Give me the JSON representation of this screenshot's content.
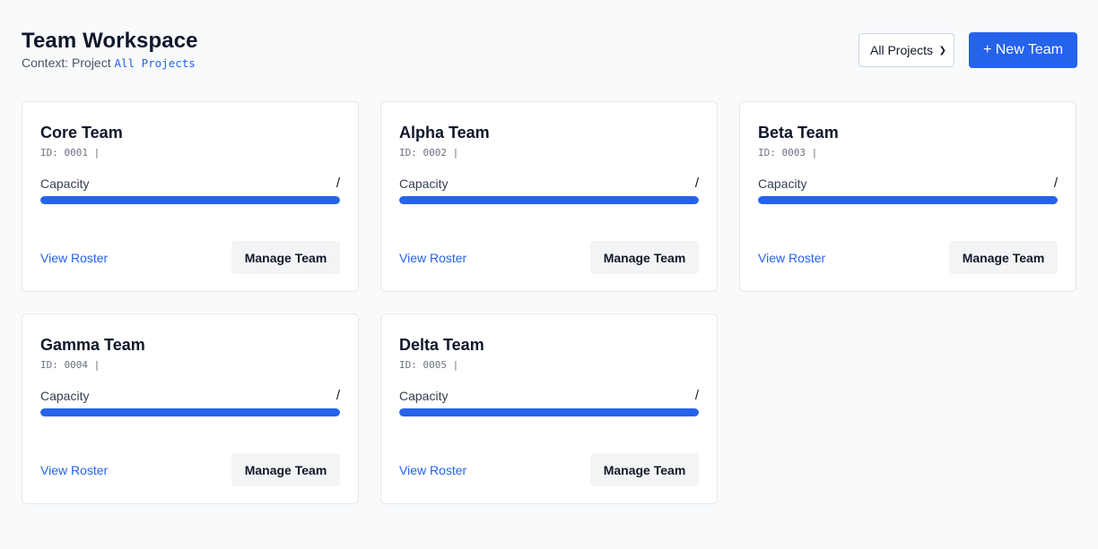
{
  "header": {
    "title": "Team Workspace",
    "context_prefix": "Context: Project",
    "context_value": "All Projects",
    "filter_selected": "All Projects",
    "new_button_label": "+ New Team"
  },
  "colors": {
    "accent": "#2563eb",
    "background": "#f8fafc",
    "card": "#ffffff"
  },
  "teams": [
    {
      "name": "Core Team",
      "id_text": "ID: 0001 |",
      "capacity_label": "Capacity",
      "capacity_value": "/",
      "capacity_fill": 1.0,
      "view_label": "View Roster",
      "manage_label": "Manage Team"
    },
    {
      "name": "Alpha Team",
      "id_text": "ID: 0002 |",
      "capacity_label": "Capacity",
      "capacity_value": "/",
      "capacity_fill": 1.0,
      "view_label": "View Roster",
      "manage_label": "Manage Team"
    },
    {
      "name": "Beta Team",
      "id_text": "ID: 0003 |",
      "capacity_label": "Capacity",
      "capacity_value": "/",
      "capacity_fill": 1.0,
      "view_label": "View Roster",
      "manage_label": "Manage Team"
    },
    {
      "name": "Gamma Team",
      "id_text": "ID: 0004 |",
      "capacity_label": "Capacity",
      "capacity_value": "/",
      "capacity_fill": 1.0,
      "view_label": "View Roster",
      "manage_label": "Manage Team"
    },
    {
      "name": "Delta Team",
      "id_text": "ID: 0005 |",
      "capacity_label": "Capacity",
      "capacity_value": "/",
      "capacity_fill": 1.0,
      "view_label": "View Roster",
      "manage_label": "Manage Team"
    }
  ]
}
